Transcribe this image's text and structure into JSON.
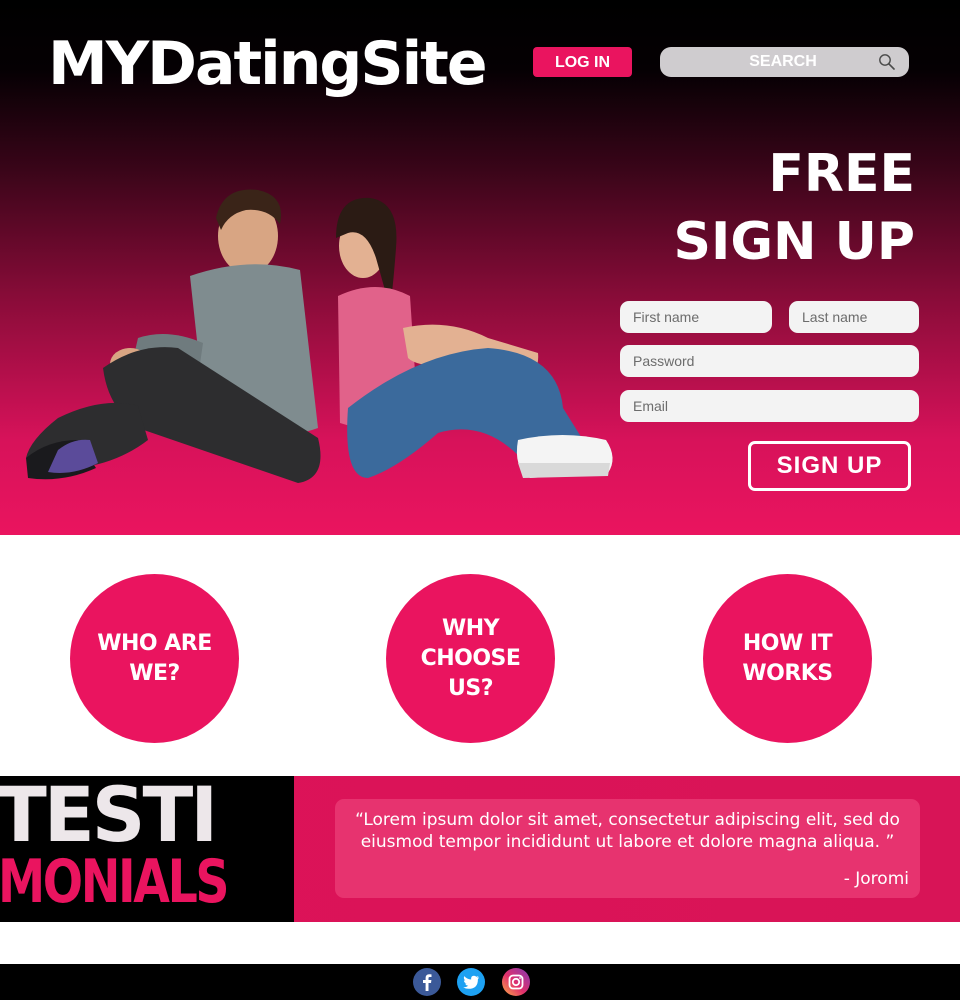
{
  "header": {
    "logo": "MYDatingSite",
    "login_label": "LOG IN",
    "search_placeholder": "SEARCH"
  },
  "hero": {
    "headline_line1": "FREE",
    "headline_line2": "SIGN UP",
    "form": {
      "first_name_placeholder": "First name",
      "last_name_placeholder": "Last name",
      "password_placeholder": "Password",
      "email_placeholder": "Email",
      "submit_label": "SIGN UP"
    }
  },
  "features": [
    {
      "label": "WHO ARE WE?"
    },
    {
      "label": "WHY CHOOSE US?"
    },
    {
      "label": "HOW IT WORKS"
    }
  ],
  "testimonials": {
    "title_line1": "TESTI",
    "title_line2": "MONIALS",
    "quote": "“Lorem ipsum dolor sit amet, consectetur adipiscing elit, sed do eiusmod tempor incididunt ut labore et dolore magna aliqua. ”",
    "author": "- Joromi"
  },
  "footer": {
    "social": [
      "facebook-icon",
      "twitter-icon",
      "instagram-icon"
    ]
  },
  "colors": {
    "accent": "#ea145f",
    "dark": "#000000",
    "quote_card": "#e7336f"
  }
}
